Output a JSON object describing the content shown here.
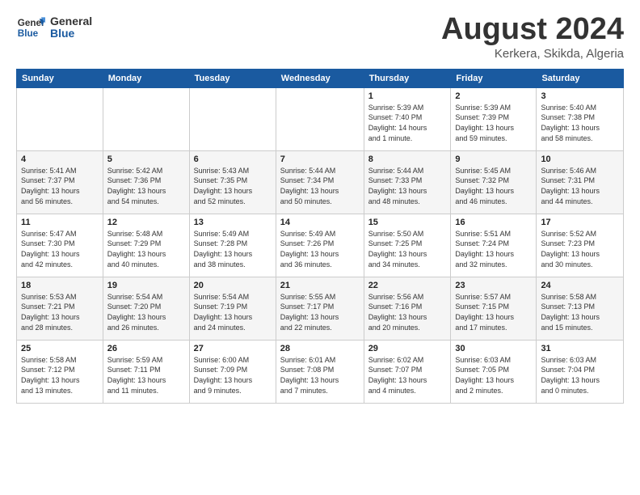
{
  "logo": {
    "line1": "General",
    "line2": "Blue"
  },
  "title": "August 2024",
  "location": "Kerkera, Skikda, Algeria",
  "days_header": [
    "Sunday",
    "Monday",
    "Tuesday",
    "Wednesday",
    "Thursday",
    "Friday",
    "Saturday"
  ],
  "weeks": [
    [
      {
        "day": "",
        "info": ""
      },
      {
        "day": "",
        "info": ""
      },
      {
        "day": "",
        "info": ""
      },
      {
        "day": "",
        "info": ""
      },
      {
        "day": "1",
        "info": "Sunrise: 5:39 AM\nSunset: 7:40 PM\nDaylight: 14 hours\nand 1 minute."
      },
      {
        "day": "2",
        "info": "Sunrise: 5:39 AM\nSunset: 7:39 PM\nDaylight: 13 hours\nand 59 minutes."
      },
      {
        "day": "3",
        "info": "Sunrise: 5:40 AM\nSunset: 7:38 PM\nDaylight: 13 hours\nand 58 minutes."
      }
    ],
    [
      {
        "day": "4",
        "info": "Sunrise: 5:41 AM\nSunset: 7:37 PM\nDaylight: 13 hours\nand 56 minutes."
      },
      {
        "day": "5",
        "info": "Sunrise: 5:42 AM\nSunset: 7:36 PM\nDaylight: 13 hours\nand 54 minutes."
      },
      {
        "day": "6",
        "info": "Sunrise: 5:43 AM\nSunset: 7:35 PM\nDaylight: 13 hours\nand 52 minutes."
      },
      {
        "day": "7",
        "info": "Sunrise: 5:44 AM\nSunset: 7:34 PM\nDaylight: 13 hours\nand 50 minutes."
      },
      {
        "day": "8",
        "info": "Sunrise: 5:44 AM\nSunset: 7:33 PM\nDaylight: 13 hours\nand 48 minutes."
      },
      {
        "day": "9",
        "info": "Sunrise: 5:45 AM\nSunset: 7:32 PM\nDaylight: 13 hours\nand 46 minutes."
      },
      {
        "day": "10",
        "info": "Sunrise: 5:46 AM\nSunset: 7:31 PM\nDaylight: 13 hours\nand 44 minutes."
      }
    ],
    [
      {
        "day": "11",
        "info": "Sunrise: 5:47 AM\nSunset: 7:30 PM\nDaylight: 13 hours\nand 42 minutes."
      },
      {
        "day": "12",
        "info": "Sunrise: 5:48 AM\nSunset: 7:29 PM\nDaylight: 13 hours\nand 40 minutes."
      },
      {
        "day": "13",
        "info": "Sunrise: 5:49 AM\nSunset: 7:28 PM\nDaylight: 13 hours\nand 38 minutes."
      },
      {
        "day": "14",
        "info": "Sunrise: 5:49 AM\nSunset: 7:26 PM\nDaylight: 13 hours\nand 36 minutes."
      },
      {
        "day": "15",
        "info": "Sunrise: 5:50 AM\nSunset: 7:25 PM\nDaylight: 13 hours\nand 34 minutes."
      },
      {
        "day": "16",
        "info": "Sunrise: 5:51 AM\nSunset: 7:24 PM\nDaylight: 13 hours\nand 32 minutes."
      },
      {
        "day": "17",
        "info": "Sunrise: 5:52 AM\nSunset: 7:23 PM\nDaylight: 13 hours\nand 30 minutes."
      }
    ],
    [
      {
        "day": "18",
        "info": "Sunrise: 5:53 AM\nSunset: 7:21 PM\nDaylight: 13 hours\nand 28 minutes."
      },
      {
        "day": "19",
        "info": "Sunrise: 5:54 AM\nSunset: 7:20 PM\nDaylight: 13 hours\nand 26 minutes."
      },
      {
        "day": "20",
        "info": "Sunrise: 5:54 AM\nSunset: 7:19 PM\nDaylight: 13 hours\nand 24 minutes."
      },
      {
        "day": "21",
        "info": "Sunrise: 5:55 AM\nSunset: 7:17 PM\nDaylight: 13 hours\nand 22 minutes."
      },
      {
        "day": "22",
        "info": "Sunrise: 5:56 AM\nSunset: 7:16 PM\nDaylight: 13 hours\nand 20 minutes."
      },
      {
        "day": "23",
        "info": "Sunrise: 5:57 AM\nSunset: 7:15 PM\nDaylight: 13 hours\nand 17 minutes."
      },
      {
        "day": "24",
        "info": "Sunrise: 5:58 AM\nSunset: 7:13 PM\nDaylight: 13 hours\nand 15 minutes."
      }
    ],
    [
      {
        "day": "25",
        "info": "Sunrise: 5:58 AM\nSunset: 7:12 PM\nDaylight: 13 hours\nand 13 minutes."
      },
      {
        "day": "26",
        "info": "Sunrise: 5:59 AM\nSunset: 7:11 PM\nDaylight: 13 hours\nand 11 minutes."
      },
      {
        "day": "27",
        "info": "Sunrise: 6:00 AM\nSunset: 7:09 PM\nDaylight: 13 hours\nand 9 minutes."
      },
      {
        "day": "28",
        "info": "Sunrise: 6:01 AM\nSunset: 7:08 PM\nDaylight: 13 hours\nand 7 minutes."
      },
      {
        "day": "29",
        "info": "Sunrise: 6:02 AM\nSunset: 7:07 PM\nDaylight: 13 hours\nand 4 minutes."
      },
      {
        "day": "30",
        "info": "Sunrise: 6:03 AM\nSunset: 7:05 PM\nDaylight: 13 hours\nand 2 minutes."
      },
      {
        "day": "31",
        "info": "Sunrise: 6:03 AM\nSunset: 7:04 PM\nDaylight: 13 hours\nand 0 minutes."
      }
    ]
  ]
}
